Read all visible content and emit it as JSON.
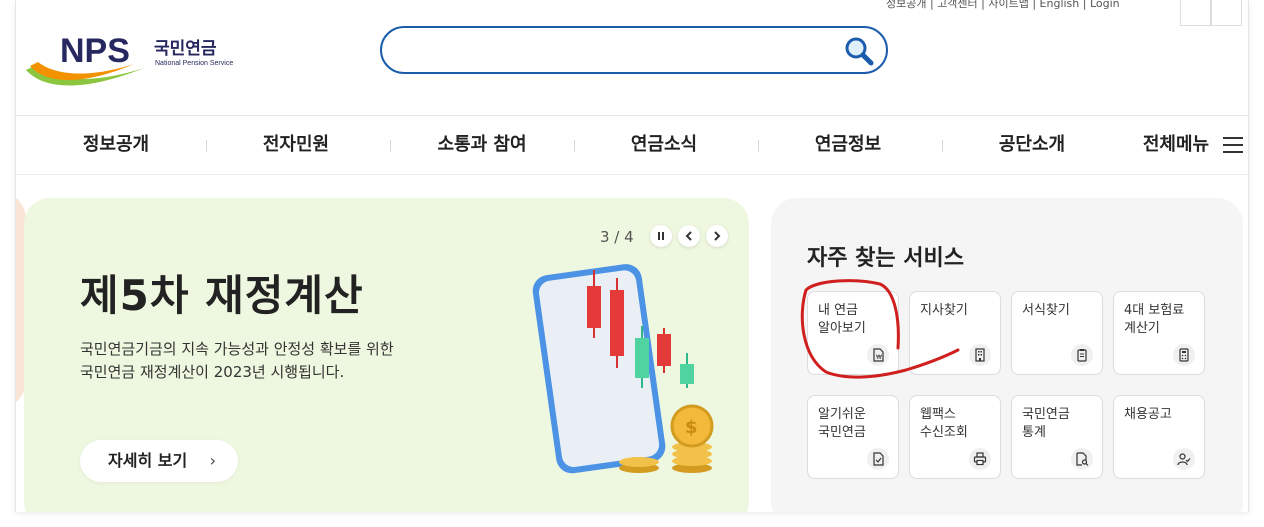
{
  "header": {
    "logo_text": "NPS",
    "logo_korean": "국민연금",
    "logo_english": "National Pension Service",
    "search_placeholder": "",
    "utility_text": "정보공개 | 고객센터 | 사이트맵 | English | Login"
  },
  "gnb": [
    {
      "label": "정보공개"
    },
    {
      "label": "전자민원"
    },
    {
      "label": "소통과 참여"
    },
    {
      "label": "연금소식"
    },
    {
      "label": "연금정보"
    },
    {
      "label": "공단소개"
    },
    {
      "label": "전체메뉴"
    }
  ],
  "banner": {
    "pager": "3 / 4",
    "title": "제5차 재정계산",
    "desc_line1": "국민연금기금의 지속 가능성과 안정성 확보를 위한",
    "desc_line2": "국민연금 재정계산이 2023년 시행됩니다.",
    "more_label": "자세히 보기",
    "more_chevron": "›"
  },
  "services": {
    "title": "자주 찾는 서비스",
    "items": [
      {
        "label": "내 연금\n알아보기",
        "icon": "pension-doc-icon"
      },
      {
        "label": "지사찾기",
        "icon": "building-icon"
      },
      {
        "label": "서식찾기",
        "icon": "clipboard-icon"
      },
      {
        "label": "4대 보험료\n계산기",
        "icon": "calculator-icon"
      },
      {
        "label": "알기쉬운\n국민연금",
        "icon": "document-check-icon"
      },
      {
        "label": "웹팩스\n수신조회",
        "icon": "printer-icon"
      },
      {
        "label": "국민연금\n통계",
        "icon": "document-search-icon"
      },
      {
        "label": "채용공고",
        "icon": "person-check-icon"
      }
    ]
  },
  "colors": {
    "brand_blue": "#1c5dab",
    "logo_navy": "#26285f",
    "banner_bg": "#eef7df",
    "annotation_red": "#d01f1f"
  }
}
